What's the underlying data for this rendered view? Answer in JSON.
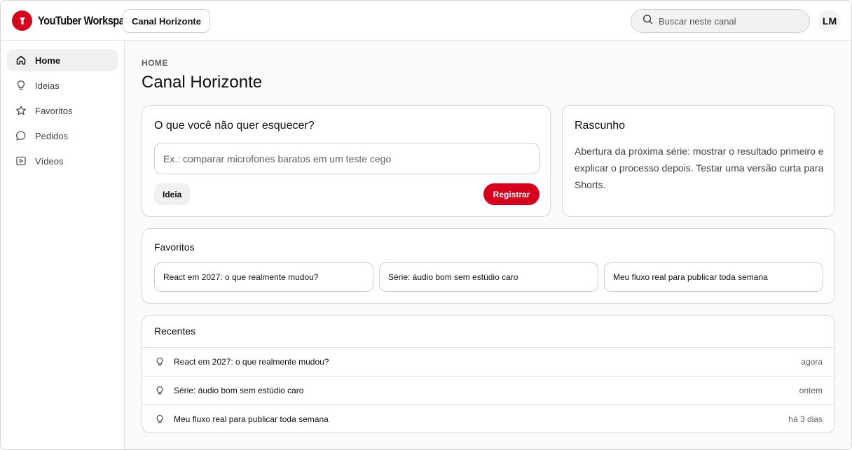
{
  "app": {
    "name": "YouTuber Workspace",
    "channel_button": "Canal Horizonte",
    "brand_color": "#d6001c"
  },
  "header": {
    "search_placeholder": "Buscar neste canal",
    "avatar_initials": "LM"
  },
  "sidebar": {
    "items": [
      {
        "label": "Home",
        "icon": "home-icon",
        "active": true
      },
      {
        "label": "Ideias",
        "icon": "lightbulb-icon",
        "active": false
      },
      {
        "label": "Favoritos",
        "icon": "star-icon",
        "active": false
      },
      {
        "label": "Pedidos",
        "icon": "chat-bubble-icon",
        "active": false
      },
      {
        "label": "Vídeos",
        "icon": "video-icon",
        "active": false
      }
    ]
  },
  "main": {
    "breadcrumb": "HOME",
    "title": "Canal Horizonte",
    "memo": {
      "heading": "O que você não quer esquecer?",
      "input_placeholder": "Ex.: comparar microfones baratos em um teste cego",
      "type_chip": "Ideia",
      "submit_label": "Registrar"
    },
    "draft": {
      "heading": "Rascunho",
      "text": "Abertura da próxima série: mostrar o resultado primeiro e explicar o processo depois. Testar uma versão curta para Shorts."
    },
    "favorites": {
      "heading": "Favoritos",
      "items": [
        "React em 2027: o que realmente mudou?",
        "Série: áudio bom sem estúdio caro",
        "Meu fluxo real para publicar toda semana"
      ]
    },
    "recent": {
      "heading": "Recentes",
      "items": [
        {
          "title": "React em 2027: o que realmente mudou?",
          "time": "agora",
          "icon": "lightbulb-icon"
        },
        {
          "title": "Série: áudio bom sem estúdio caro",
          "time": "ontem",
          "icon": "lightbulb-icon"
        },
        {
          "title": "Meu fluxo real para publicar toda semana",
          "time": "há 3 dias",
          "icon": "lightbulb-icon"
        }
      ]
    }
  }
}
